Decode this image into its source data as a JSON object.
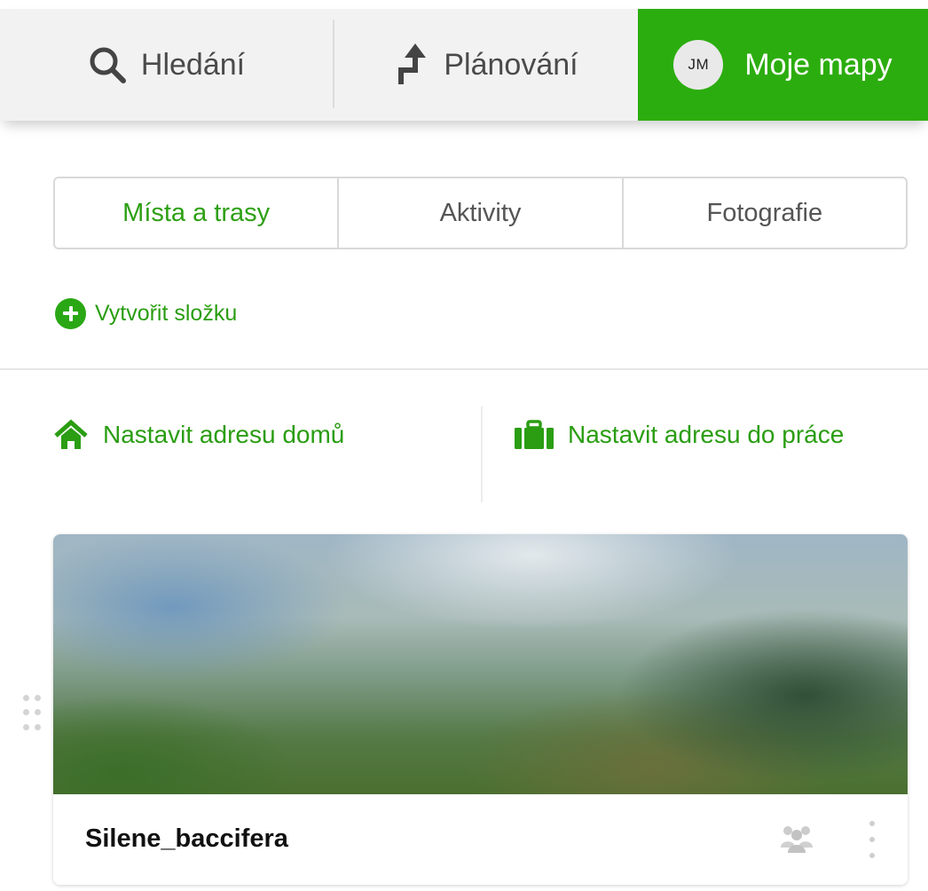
{
  "topnav": {
    "tabs": [
      {
        "label": "Hledání",
        "icon": "search-icon"
      },
      {
        "label": "Plánování",
        "icon": "route-turn-icon"
      },
      {
        "label": "Moje mapy",
        "avatar_initials": "JM",
        "active": true
      }
    ]
  },
  "subtabs": [
    {
      "label": "Místa a trasy",
      "active": true
    },
    {
      "label": "Aktivity",
      "active": false
    },
    {
      "label": "Fotografie",
      "active": false
    }
  ],
  "actions": {
    "create_folder": "Vytvořit složku",
    "home_address": "Nastavit adresu domů",
    "work_address": "Nastavit adresu do práce"
  },
  "card": {
    "title": "Silene_baccifera",
    "shared_icon": "shared-users-icon",
    "menu_icon": "kebab-menu-icon"
  },
  "colors": {
    "accent_green": "#2cad0f",
    "link_green": "#2a9d12",
    "nav_background": "#f2f2f2"
  }
}
